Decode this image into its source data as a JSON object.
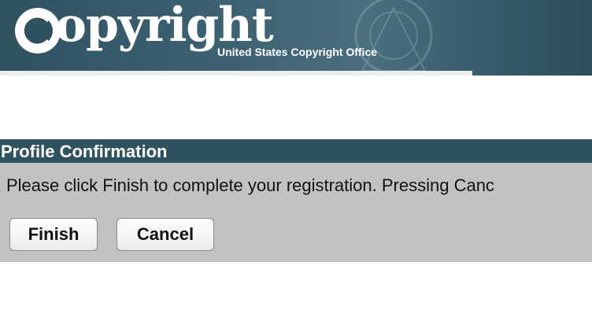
{
  "header": {
    "logo_word": "opyright",
    "logo_subtitle": "United States Copyright Office",
    "colors": {
      "banner": "#2f5261",
      "logo_text": "#ffffff"
    }
  },
  "section": {
    "title": "Profile Confirmation",
    "color": "#2f5261"
  },
  "panel": {
    "message": "Please click Finish to complete your registration. Pressing Canc",
    "background": "#c2c2c2"
  },
  "buttons": {
    "finish_label": "Finish",
    "cancel_label": "Cancel"
  }
}
